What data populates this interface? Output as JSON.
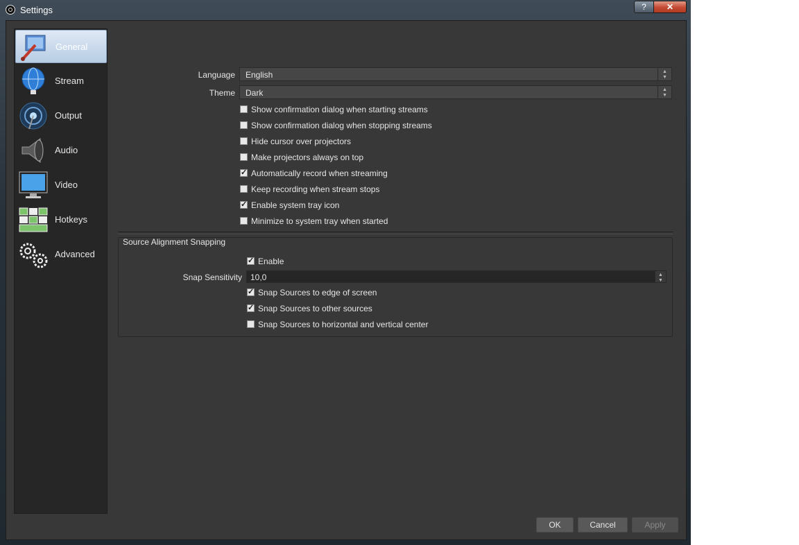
{
  "window": {
    "title": "Settings",
    "help_glyph": "?",
    "close_glyph": "✕"
  },
  "sidebar": {
    "items": [
      {
        "label": "General",
        "icon": "general-icon",
        "active": true
      },
      {
        "label": "Stream",
        "icon": "globe-icon"
      },
      {
        "label": "Output",
        "icon": "broadcast-icon"
      },
      {
        "label": "Audio",
        "icon": "speaker-icon"
      },
      {
        "label": "Video",
        "icon": "monitor-icon"
      },
      {
        "label": "Hotkeys",
        "icon": "keyboard-icon"
      },
      {
        "label": "Advanced",
        "icon": "gears-icon"
      }
    ]
  },
  "general": {
    "language_label": "Language",
    "language_value": "English",
    "theme_label": "Theme",
    "theme_value": "Dark",
    "options": [
      {
        "label": "Show confirmation dialog when starting streams",
        "checked": false
      },
      {
        "label": "Show confirmation dialog when stopping streams",
        "checked": false
      },
      {
        "label": "Hide cursor over projectors",
        "checked": false
      },
      {
        "label": "Make projectors always on top",
        "checked": false
      },
      {
        "label": "Automatically record when streaming",
        "checked": true
      },
      {
        "label": "Keep recording when stream stops",
        "checked": false
      },
      {
        "label": "Enable system tray icon",
        "checked": true
      },
      {
        "label": "Minimize to system tray when started",
        "checked": false
      }
    ]
  },
  "snapping": {
    "group_title": "Source Alignment Snapping",
    "enable_label": "Enable",
    "enable_checked": true,
    "sensitivity_label": "Snap Sensitivity",
    "sensitivity_value": "10,0",
    "options": [
      {
        "label": "Snap Sources to edge of screen",
        "checked": true
      },
      {
        "label": "Snap Sources to other sources",
        "checked": true
      },
      {
        "label": "Snap Sources to horizontal and vertical center",
        "checked": false
      }
    ]
  },
  "buttons": {
    "ok": "OK",
    "cancel": "Cancel",
    "apply": "Apply"
  },
  "glyphs": {
    "check": "✓",
    "spin_up": "▲",
    "spin_down": "▼"
  },
  "colors": {
    "background": "#383838",
    "sidebar": "#262626",
    "active_item": "#b7cde4"
  }
}
